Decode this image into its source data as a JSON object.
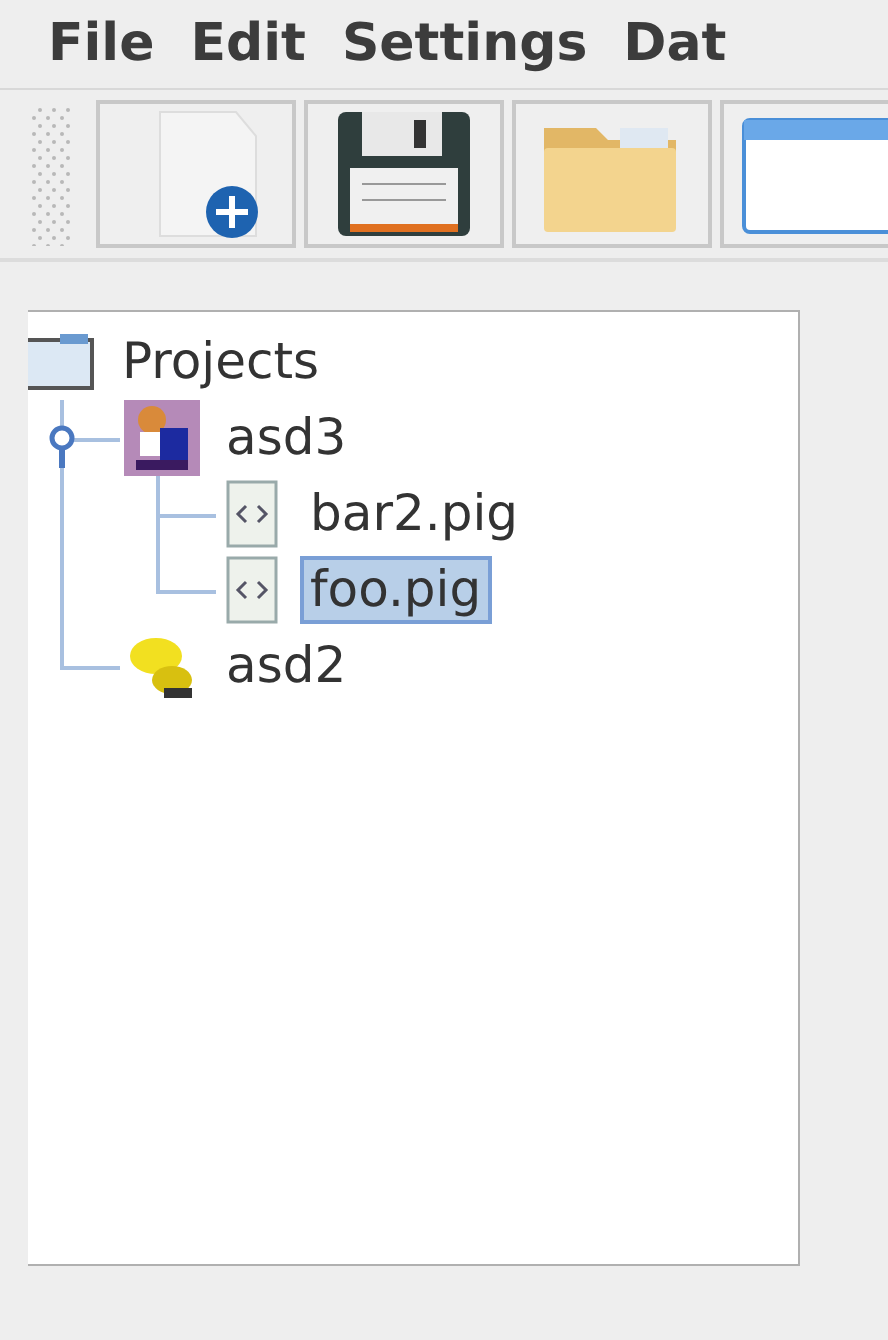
{
  "menu": [
    {
      "label": "File"
    },
    {
      "label": "Edit"
    },
    {
      "label": "Settings"
    },
    {
      "label": "Dat"
    }
  ],
  "toolbar": [
    {
      "kind": "new-file"
    },
    {
      "kind": "save"
    },
    {
      "kind": "folder"
    },
    {
      "kind": "window"
    }
  ],
  "tree": [
    {
      "label": "Projects",
      "kind": "root",
      "selected": false,
      "children": [
        {
          "label": "asd3",
          "kind": "bear",
          "expanded": true,
          "selected": false,
          "children": [
            {
              "label": "bar2.pig",
              "kind": "file",
              "selected": false
            },
            {
              "label": "foo.pig",
              "kind": "file",
              "selected": true
            }
          ]
        },
        {
          "label": "asd2",
          "kind": "duck",
          "selected": false
        }
      ]
    }
  ]
}
